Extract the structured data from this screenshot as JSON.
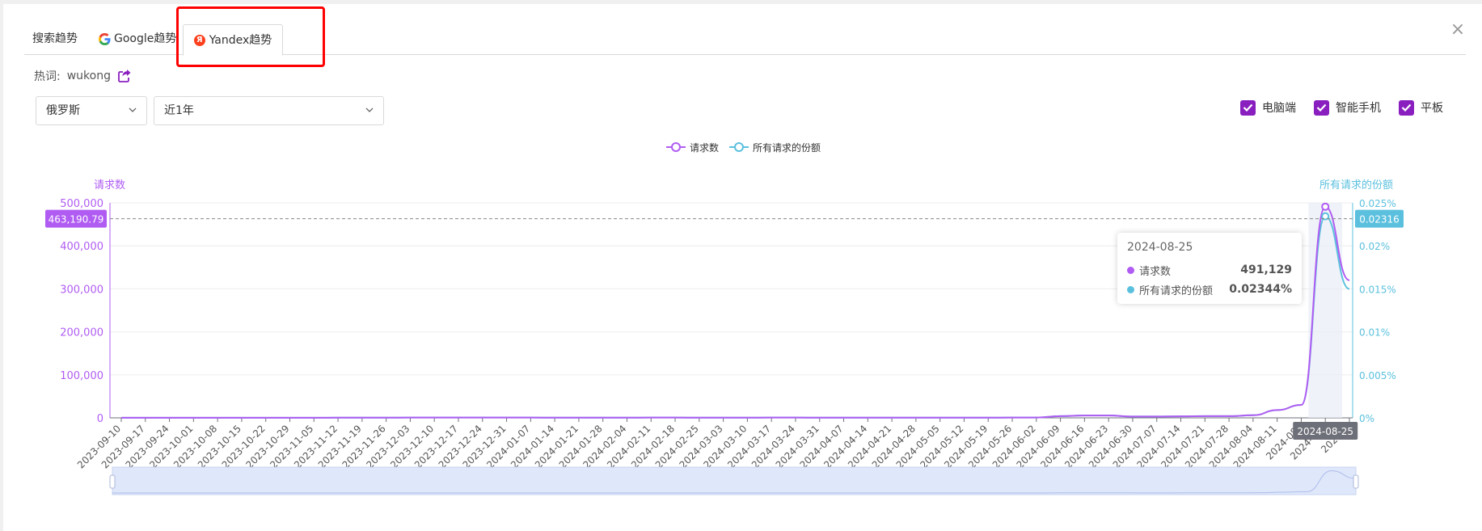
{
  "tabs": [
    {
      "label": "搜索趋势"
    },
    {
      "label": "Google趋势"
    },
    {
      "label": "Yandex趋势"
    }
  ],
  "close_label": "×",
  "keyword": {
    "label": "热词:",
    "value": "wukong"
  },
  "filters": {
    "country": "俄罗斯",
    "range": "近1年"
  },
  "devices": [
    {
      "label": "电脑端",
      "checked": true
    },
    {
      "label": "智能手机",
      "checked": true
    },
    {
      "label": "平板",
      "checked": true
    }
  ],
  "tooltip": {
    "date": "2024-08-25",
    "rows": [
      {
        "name": "请求数",
        "value": "491,129"
      },
      {
        "name": "所有请求的份额",
        "value": "0.02344%"
      }
    ]
  },
  "colors": {
    "accent": "#8a1fc0",
    "requests": "#b05cf2",
    "share": "#5bc0de",
    "highlight": "#ff0000"
  },
  "chart_data": {
    "type": "line",
    "left_axis_label": "请求数",
    "right_axis_label": "所有请求的份额",
    "ylim_left": [
      0,
      500000
    ],
    "yticks_left": [
      "0",
      "100,000",
      "200,000",
      "300,000",
      "400,000",
      "500,000"
    ],
    "ylim_right": [
      0,
      0.025
    ],
    "yticks_right": [
      "0%",
      "0.005%",
      "0.01%",
      "0.015%",
      "0.02%",
      "0.025%"
    ],
    "crosshair_left_label": "463,190.79",
    "crosshair_right_label": "0.02316",
    "crosshair_left_value": 463190.79,
    "active_x_label": "2024-08-25",
    "x": [
      "2023-09-10",
      "2023-09-17",
      "2023-09-24",
      "2023-10-01",
      "2023-10-08",
      "2023-10-15",
      "2023-10-22",
      "2023-10-29",
      "2023-11-05",
      "2023-11-12",
      "2023-11-19",
      "2023-11-26",
      "2023-12-03",
      "2023-12-10",
      "2023-12-17",
      "2023-12-24",
      "2023-12-31",
      "2024-01-07",
      "2024-01-14",
      "2024-01-21",
      "2024-01-28",
      "2024-02-04",
      "2024-02-11",
      "2024-02-18",
      "2024-02-25",
      "2024-03-03",
      "2024-03-10",
      "2024-03-17",
      "2024-03-24",
      "2024-03-31",
      "2024-04-07",
      "2024-04-14",
      "2024-04-21",
      "2024-04-28",
      "2024-05-05",
      "2024-05-12",
      "2024-05-19",
      "2024-05-26",
      "2024-06-02",
      "2024-06-09",
      "2024-06-16",
      "2024-06-23",
      "2024-06-30",
      "2024-07-07",
      "2024-07-14",
      "2024-07-21",
      "2024-07-28",
      "2024-08-04",
      "2024-08-11",
      "2024-08-18",
      "2024-08-25",
      "2024-09-01"
    ],
    "x_tick_text": [
      "2023-09-10",
      "2023-09-17",
      "2023-09-24",
      "2023-10-01",
      "2023-10-08",
      "2023-10-15",
      "2023-10-22",
      "2023-10-29",
      "2023-11-05",
      "2023-11-12",
      "2023-11-19",
      "2023-11-26",
      "2023-12-03",
      "2023-12-10",
      "2023-12-17",
      "2023-12-24",
      "2023-12-31",
      "2024-01-07",
      "2024-01-14",
      "2024-01-21",
      "2024-01-28",
      "2024-02-04",
      "2024-02-11",
      "2024-02-18",
      "2024-02-25",
      "2024-03-03",
      "2024-03-10",
      "2024-03-17",
      "2024-03-24",
      "2024-03-31",
      "2024-04-07",
      "2024-04-14",
      "2024-04-21",
      "2024-04-28",
      "2024-05-05",
      "2024-05-12",
      "2024-05-19",
      "2024-05-26",
      "2024-06-02",
      "2024-06-09",
      "2024-06-16",
      "2024-06-23",
      "2024-06-30",
      "2024-07-07",
      "2024-07-14",
      "2024-07-21",
      "2024-07-28",
      "2024-08-04",
      "2024-08-11",
      "2024-08-",
      "2024-08-",
      "2024-0"
    ],
    "series": [
      {
        "name": "请求数",
        "axis": "left",
        "values": [
          200,
          200,
          200,
          200,
          300,
          300,
          300,
          300,
          300,
          400,
          400,
          500,
          600,
          700,
          700,
          700,
          600,
          600,
          500,
          500,
          500,
          500,
          600,
          600,
          500,
          500,
          500,
          600,
          600,
          500,
          500,
          500,
          500,
          500,
          500,
          500,
          500,
          600,
          800,
          4000,
          5500,
          5500,
          3000,
          3000,
          3500,
          4000,
          4000,
          6000,
          18000,
          30000,
          491129,
          320000
        ]
      },
      {
        "name": "所有请求的份额",
        "axis": "right",
        "values": [
          1e-05,
          1e-05,
          1e-05,
          1e-05,
          1e-05,
          1e-05,
          1e-05,
          1e-05,
          1e-05,
          2e-05,
          2e-05,
          2e-05,
          3e-05,
          3e-05,
          3e-05,
          3e-05,
          3e-05,
          3e-05,
          2e-05,
          2e-05,
          2e-05,
          2e-05,
          3e-05,
          3e-05,
          2e-05,
          2e-05,
          2e-05,
          3e-05,
          3e-05,
          2e-05,
          2e-05,
          2e-05,
          2e-05,
          2e-05,
          2e-05,
          2e-05,
          2e-05,
          3e-05,
          4e-05,
          0.0002,
          0.00028,
          0.00028,
          0.00015,
          0.00015,
          0.00018,
          0.0002,
          0.0002,
          0.0003,
          0.0009,
          0.0015,
          0.02344,
          0.015
        ]
      }
    ],
    "grid": true,
    "legend_position": "top-center"
  }
}
